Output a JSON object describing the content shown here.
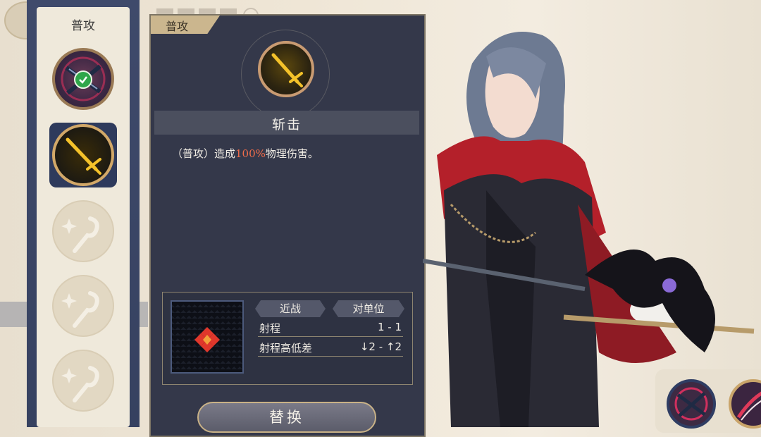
{
  "left_column": {
    "title": "普攻",
    "slots": [
      {
        "icon": "crossed-swords-icon",
        "state": "equipped"
      },
      {
        "icon": "golden-sword-icon",
        "state": "selected"
      },
      {
        "icon": "sparkle-staff-icon",
        "state": "empty"
      },
      {
        "icon": "sparkle-staff-icon",
        "state": "empty"
      },
      {
        "icon": "sparkle-staff-icon",
        "state": "empty"
      }
    ]
  },
  "detail": {
    "tab_label": "普攻",
    "skill_name": "斩击",
    "desc_prefix": "（普攻）造成",
    "desc_highlight": "100%",
    "desc_suffix": "物理伤害。",
    "tags": [
      "近战",
      "对单位"
    ],
    "stats": [
      {
        "label": "射程",
        "value": "1 - 1"
      },
      {
        "label": "射程高低差",
        "value": "↓2 - ↑2"
      }
    ],
    "replace_button": "替换"
  },
  "colors": {
    "panel_bg": "#34384a",
    "highlight": "#f26d4b",
    "gold_frame": "#c99b72",
    "range_red": "#e0372b",
    "range_orange": "#f3a23b",
    "check_green": "#2fa64a"
  }
}
